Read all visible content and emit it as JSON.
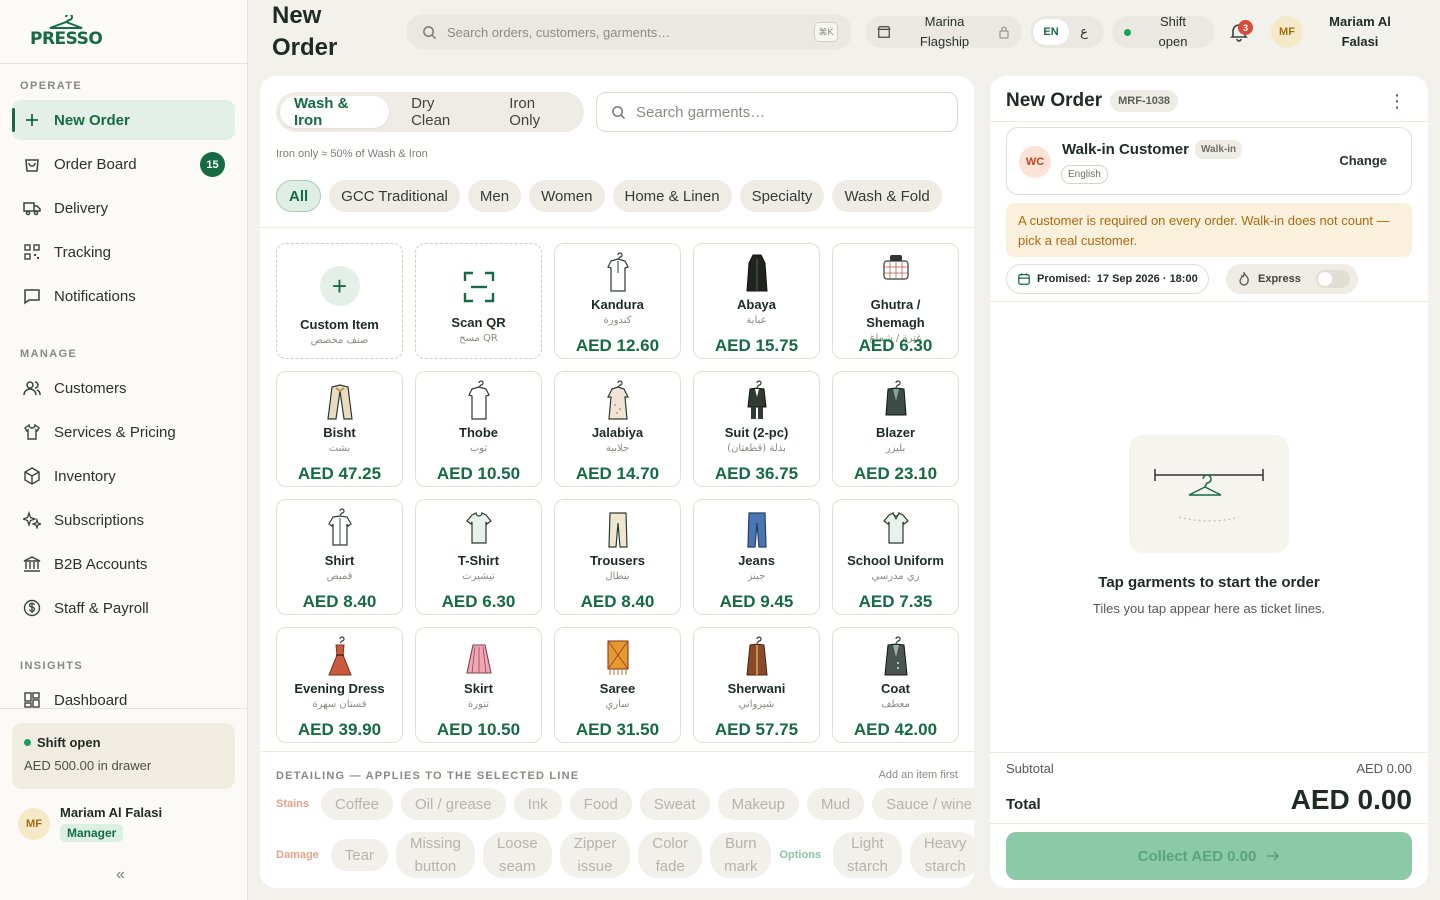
{
  "brand": {
    "name": "PRESSO",
    "accent": "#156b43"
  },
  "sidebar": {
    "sections": [
      {
        "title": "OPERATE",
        "items": [
          {
            "label": "New Order",
            "icon": "plus-icon",
            "active": true
          },
          {
            "label": "Order Board",
            "icon": "bag-icon",
            "badge": "15"
          },
          {
            "label": "Delivery",
            "icon": "truck-icon"
          },
          {
            "label": "Tracking",
            "icon": "qr-icon"
          },
          {
            "label": "Notifications",
            "icon": "message-icon"
          }
        ]
      },
      {
        "title": "MANAGE",
        "items": [
          {
            "label": "Customers",
            "icon": "users-icon"
          },
          {
            "label": "Services & Pricing",
            "icon": "shirt-icon"
          },
          {
            "label": "Inventory",
            "icon": "box-icon"
          },
          {
            "label": "Subscriptions",
            "icon": "sparkle-icon"
          },
          {
            "label": "B2B Accounts",
            "icon": "bank-icon"
          },
          {
            "label": "Staff & Payroll",
            "icon": "dollar-icon"
          }
        ]
      },
      {
        "title": "INSIGHTS",
        "items": [
          {
            "label": "Dashboard",
            "icon": "grid-icon"
          }
        ]
      }
    ],
    "shift": {
      "title": "Shift open",
      "drawer": "AED 500.00 in drawer"
    },
    "user": {
      "initials": "MF",
      "name": "Mariam Al Falasi",
      "role": "Manager"
    },
    "collapse": "«"
  },
  "topbar": {
    "title_line1": "New",
    "title_line2": "Order",
    "search_placeholder": "Search orders, customers, garments…",
    "shortcut": "⌘K",
    "store_line1": "Marina",
    "store_line2": "Flagship",
    "lang_on": "EN",
    "lang_off": "ع",
    "shift_line1": "Shift",
    "shift_line2": "open",
    "notifications": "3",
    "user_initials": "MF",
    "user_line1": "Mariam Al",
    "user_line2": "Falasi"
  },
  "catalog": {
    "services": [
      "Wash & Iron",
      "Dry Clean",
      "Iron Only"
    ],
    "search_placeholder": "Search garments…",
    "hint": "Iron only ≈ 50% of Wash & Iron",
    "categories": [
      "All",
      "GCC Traditional",
      "Men",
      "Women",
      "Home & Linen",
      "Specialty",
      "Wash & Fold"
    ],
    "tiles": [
      {
        "name": "Custom Item",
        "ar": "صنف مخصص",
        "type": "custom"
      },
      {
        "name": "Scan QR",
        "ar": "مسح QR",
        "type": "scan"
      },
      {
        "name": "Kandura",
        "ar": "كندورة",
        "price": "AED 12.60",
        "icon": "kandura-icon"
      },
      {
        "name": "Abaya",
        "ar": "عباية",
        "price": "AED 15.75",
        "icon": "abaya-icon"
      },
      {
        "name": "Ghutra / Shemagh",
        "ar": "غترة / شماغ",
        "price": "AED 6.30",
        "icon": "ghutra-icon"
      },
      {
        "name": "Bisht",
        "ar": "بشت",
        "price": "AED 47.25",
        "icon": "bisht-icon"
      },
      {
        "name": "Thobe",
        "ar": "ثوب",
        "price": "AED 10.50",
        "icon": "thobe-icon"
      },
      {
        "name": "Jalabiya",
        "ar": "جلابية",
        "price": "AED 14.70",
        "icon": "jalabiya-icon"
      },
      {
        "name": "Suit (2-pc)",
        "ar": "بدلة (قطعتان)",
        "price": "AED 36.75",
        "icon": "suit-icon"
      },
      {
        "name": "Blazer",
        "ar": "بليزر",
        "price": "AED 23.10",
        "icon": "blazer-icon"
      },
      {
        "name": "Shirt",
        "ar": "قميص",
        "price": "AED 8.40",
        "icon": "shirt-icon"
      },
      {
        "name": "T-Shirt",
        "ar": "تيشيرت",
        "price": "AED 6.30",
        "icon": "tshirt-icon"
      },
      {
        "name": "Trousers",
        "ar": "بنطال",
        "price": "AED 8.40",
        "icon": "trousers-icon"
      },
      {
        "name": "Jeans",
        "ar": "جينز",
        "price": "AED 9.45",
        "icon": "jeans-icon"
      },
      {
        "name": "School Uniform",
        "ar": "زي مدرسي",
        "price": "AED 7.35",
        "icon": "uniform-icon"
      },
      {
        "name": "Evening Dress",
        "ar": "فستان سهرة",
        "price": "AED 39.90",
        "icon": "dress-icon"
      },
      {
        "name": "Skirt",
        "ar": "تنورة",
        "price": "AED 10.50",
        "icon": "skirt-icon"
      },
      {
        "name": "Saree",
        "ar": "ساري",
        "price": "AED 31.50",
        "icon": "saree-icon"
      },
      {
        "name": "Sherwani",
        "ar": "شيرواني",
        "price": "AED 57.75",
        "icon": "sherwani-icon"
      },
      {
        "name": "Coat",
        "ar": "معطف",
        "price": "AED 42.00",
        "icon": "coat-icon"
      }
    ],
    "detailing": {
      "title": "DETAILING — APPLIES TO THE SELECTED LINE",
      "hint": "Add an item first",
      "stains_label": "Stains",
      "stains": [
        "Coffee",
        "Oil / grease",
        "Ink",
        "Food",
        "Sweat",
        "Makeup",
        "Mud",
        "Sauce / wine"
      ],
      "damage_label": "Damage",
      "damage": [
        [
          "Tear"
        ],
        [
          "Missing",
          "button"
        ],
        [
          "Loose",
          "seam"
        ],
        [
          "Zipper",
          "issue"
        ],
        [
          "Color",
          "fade"
        ],
        [
          "Burn",
          "mark"
        ]
      ],
      "options_label": "Options",
      "options": [
        [
          "Light",
          "starch"
        ],
        [
          "Heavy",
          "starch"
        ]
      ]
    }
  },
  "order": {
    "title": "New Order",
    "ref": "MRF-1038",
    "customer": {
      "initials": "WC",
      "name": "Walk-in Customer",
      "badge": "Walk-in",
      "lang": "English",
      "change": "Change"
    },
    "warning": "A customer is required on every order. Walk-in does not count — pick a real customer.",
    "promised_label": "Promised:",
    "promised_value": "17 Sep 2026 · 18:00",
    "express": "Express",
    "empty_title": "Tap garments to start the order",
    "empty_sub": "Tiles you tap appear here as ticket lines.",
    "subtotal_label": "Subtotal",
    "subtotal": "AED 0.00",
    "total_label": "Total",
    "total": "AED 0.00",
    "collect": "Collect AED 0.00"
  }
}
